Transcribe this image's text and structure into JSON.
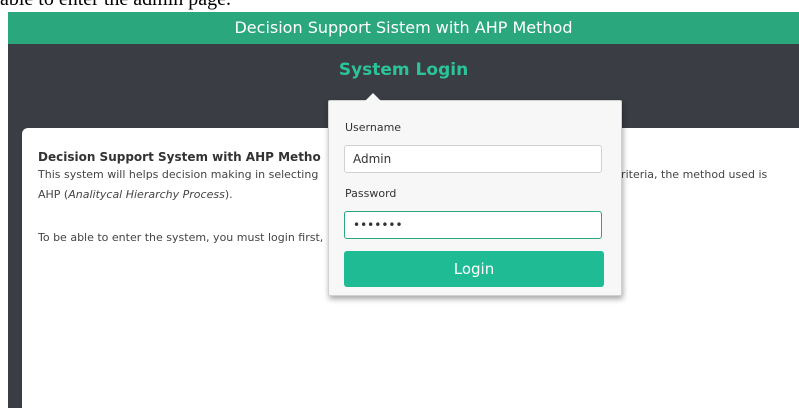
{
  "caption": "able to enter the admin page.",
  "app": {
    "title": "Decision Support Sistem with AHP Method",
    "login_heading": "System Login"
  },
  "card": {
    "title": "Decision Support System with AHP Metho",
    "line1_start": "This system will helps decision making in selecting",
    "line1_end": "criteria, the method used is",
    "line2_prefix": "AHP (",
    "line2_italic": "Analitycal Hierarchy Process",
    "line2_suffix": ").",
    "line3": "To be able to enter the system, you must login first,"
  },
  "login_form": {
    "username_label": "Username",
    "username_value": "Admin",
    "password_label": "Password",
    "password_value": "•••••••",
    "login_button": "Login"
  },
  "colors": {
    "title_bar": "#2aa77d",
    "accent": "#1fbb95",
    "dark_panel": "#3a3d44"
  }
}
